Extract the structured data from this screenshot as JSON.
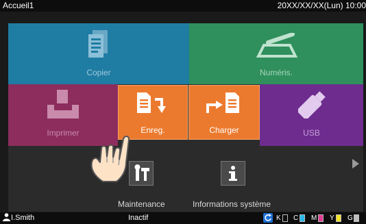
{
  "header": {
    "title": "Accueil1",
    "datetime": "20XX/XX/XX(Lun) 10:00"
  },
  "tiles": {
    "copy": "Copier",
    "scan": "Numéris.",
    "print": "Imprimer",
    "store": "Enreg.",
    "load": "Charger",
    "usb": "USB",
    "maintenance": "Maintenance",
    "sysinfo": "Informations système"
  },
  "status": {
    "user": "I.Smith",
    "state": "Inactif",
    "inks": [
      {
        "label": "K",
        "color": "#ffffff"
      },
      {
        "label": "C",
        "color": "#27b8e8"
      },
      {
        "label": "M",
        "color": "#e23c8f"
      },
      {
        "label": "Y",
        "color": "#f2e22a"
      },
      {
        "label": "G",
        "color": "#bdbdbd"
      }
    ]
  },
  "colors": {
    "copy": "#1f7ca3",
    "scan": "#2f8f5d",
    "print": "#8c2d5d",
    "store_load": "#ec7a2e",
    "usb": "#6e2c8f"
  }
}
